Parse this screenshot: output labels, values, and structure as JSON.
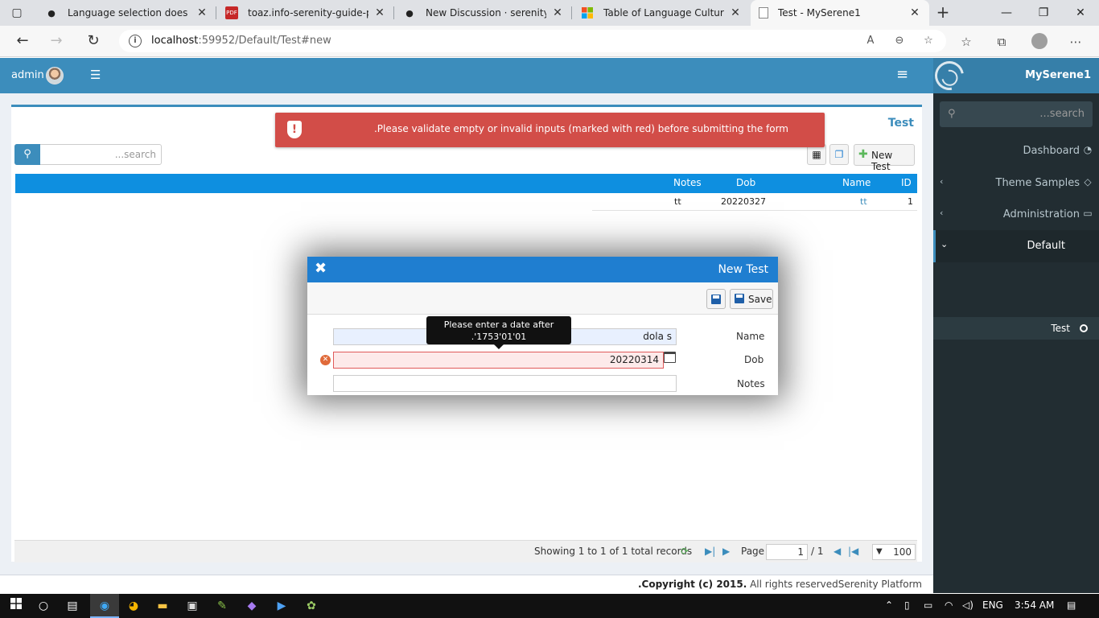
{
  "browser": {
    "tabs": [
      {
        "title": "Language selection does not",
        "favicon": "github-icon"
      },
      {
        "title": "toaz.info-serenity-guide-pr_d",
        "favicon": "pdf-icon"
      },
      {
        "title": "New Discussion · serenity-is/S",
        "favicon": "github-icon"
      },
      {
        "title": "Table of Language Culture Na",
        "favicon": "microsoft-icon"
      },
      {
        "title": "Test - MySerene1",
        "favicon": "page-icon",
        "active": true
      }
    ],
    "url_host": "localhost",
    "url_path": ":59952/Default/Test#new"
  },
  "header": {
    "username": "admin"
  },
  "sidebar": {
    "brand": "MySerene1",
    "search_placeholder": "...search",
    "items": [
      {
        "label": "Dashboard",
        "icon": "dashboard-icon",
        "has_children": false
      },
      {
        "label": "Theme Samples",
        "icon": "diamond-icon",
        "has_children": true
      },
      {
        "label": "Administration",
        "icon": "desktop-icon",
        "has_children": true
      },
      {
        "label": "Default",
        "icon": "",
        "has_children": true,
        "expanded": true
      }
    ],
    "sub_items": [
      {
        "label": "Test",
        "icon": "circle-icon"
      }
    ]
  },
  "page": {
    "title": "Test",
    "search_placeholder": "...search",
    "new_button": "New Test",
    "columns": [
      "Notes",
      "Dob",
      "Name",
      "ID"
    ],
    "rows": [
      {
        "notes": "tt",
        "dob": "20220327",
        "name": "tt",
        "id": "1"
      }
    ],
    "pager": {
      "summary": "Showing 1 to 1 of 1 total records",
      "page_label": "Page",
      "page_value": "1",
      "page_total": "/ 1",
      "page_size": "100"
    }
  },
  "alert": {
    "message": ".Please validate empty or invalid inputs (marked with red) before submitting the form"
  },
  "dialog": {
    "title": "New Test",
    "save_label": "Save",
    "fields": {
      "name_label": "Name",
      "name_value": "dola s",
      "dob_label": "Dob",
      "dob_value": "20220314",
      "notes_label": "Notes",
      "notes_value": ""
    },
    "tooltip_line1": "Please enter a date after",
    "tooltip_line2": ".'1753'01'01"
  },
  "footer": {
    "copyright": ".Copyright (c) 2015.",
    "rights": " All rights reservedSerenity Platform"
  },
  "taskbar": {
    "language": "ENG",
    "time": "3:54 AM"
  },
  "colors": {
    "header": "#3c8dbc",
    "sidebar": "#222d32",
    "alert": "#d24d48",
    "dialog_title": "#1f7ed0",
    "grid_header": "#0e8fe0"
  }
}
